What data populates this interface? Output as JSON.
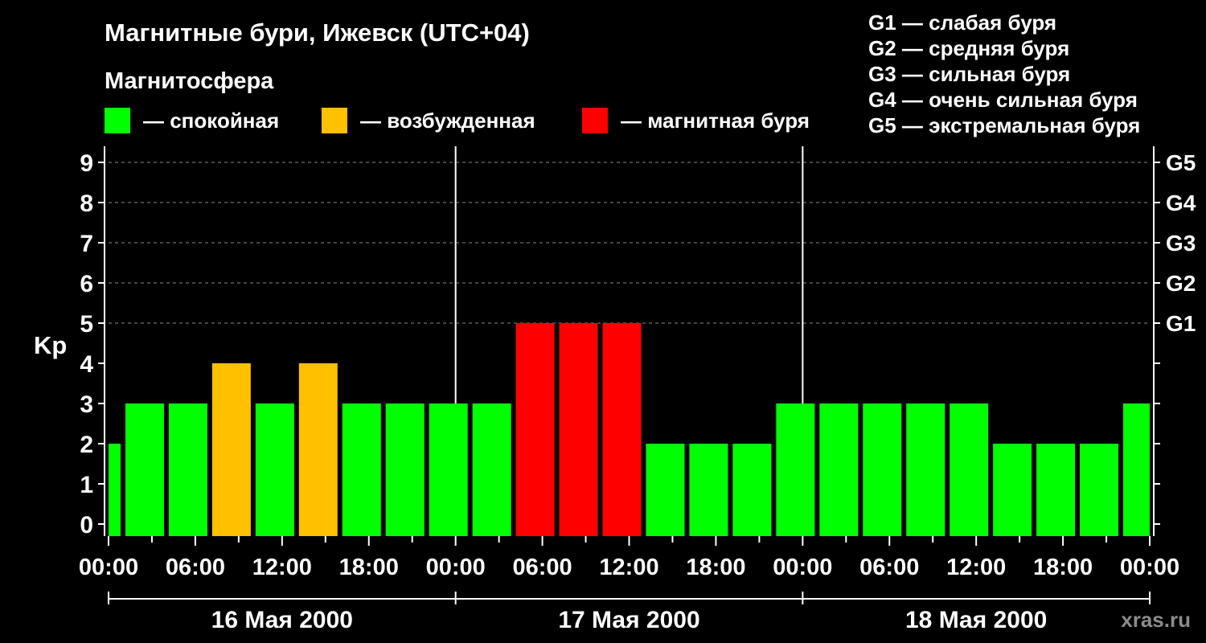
{
  "chart_data": {
    "type": "bar",
    "title": "Магнитные бури, Ижевск (UTC+04)",
    "ylabel": "Kp",
    "ylim": [
      -0.3,
      9.4
    ],
    "yticks": [
      0,
      1,
      2,
      3,
      4,
      5,
      6,
      7,
      8,
      9
    ],
    "xlim": [
      "2000-05-16 00:00",
      "2000-05-19 00:00"
    ],
    "xtick_labels": [
      "00:00",
      "06:00",
      "12:00",
      "18:00",
      "00:00",
      "06:00",
      "12:00",
      "18:00",
      "00:00",
      "06:00",
      "12:00",
      "18:00",
      "00:00"
    ],
    "days": [
      "16 Мая 2000",
      "17 Мая 2000",
      "18 Мая 2000"
    ],
    "grid": true,
    "legend": {
      "title": "Магнитосфера",
      "position": "top-left",
      "items": [
        {
          "label": "— спокойная",
          "color": "#00ff00"
        },
        {
          "label": "— возбужденная",
          "color": "#ffc000"
        },
        {
          "label": "— магнитная буря",
          "color": "#ff0000"
        }
      ]
    },
    "storm_scale": {
      "position": "top-right",
      "levels": [
        {
          "label": "G1",
          "kp": 5,
          "legend": "G1 — слабая буря"
        },
        {
          "label": "G2",
          "kp": 6,
          "legend": "G2 — средняя буря"
        },
        {
          "label": "G3",
          "kp": 7,
          "legend": "G3 — сильная буря"
        },
        {
          "label": "G4",
          "kp": 8,
          "legend": "G4 — очень сильная буря"
        },
        {
          "label": "G5",
          "kp": 9,
          "legend": "G5 — экстремальная буря"
        }
      ]
    },
    "bars": [
      {
        "start": "2000-05-16 00:00",
        "end": "2000-05-16 01:00",
        "kp": 2,
        "color": "#00ff00"
      },
      {
        "start": "2000-05-16 01:00",
        "end": "2000-05-16 04:00",
        "kp": 3,
        "color": "#00ff00"
      },
      {
        "start": "2000-05-16 04:00",
        "end": "2000-05-16 07:00",
        "kp": 3,
        "color": "#00ff00"
      },
      {
        "start": "2000-05-16 07:00",
        "end": "2000-05-16 10:00",
        "kp": 4,
        "color": "#ffc000"
      },
      {
        "start": "2000-05-16 10:00",
        "end": "2000-05-16 13:00",
        "kp": 3,
        "color": "#00ff00"
      },
      {
        "start": "2000-05-16 13:00",
        "end": "2000-05-16 16:00",
        "kp": 4,
        "color": "#ffc000"
      },
      {
        "start": "2000-05-16 16:00",
        "end": "2000-05-16 19:00",
        "kp": 3,
        "color": "#00ff00"
      },
      {
        "start": "2000-05-16 19:00",
        "end": "2000-05-16 22:00",
        "kp": 3,
        "color": "#00ff00"
      },
      {
        "start": "2000-05-16 22:00",
        "end": "2000-05-17 01:00",
        "kp": 3,
        "color": "#00ff00"
      },
      {
        "start": "2000-05-17 01:00",
        "end": "2000-05-17 04:00",
        "kp": 3,
        "color": "#00ff00"
      },
      {
        "start": "2000-05-17 04:00",
        "end": "2000-05-17 07:00",
        "kp": 5,
        "color": "#ff0000"
      },
      {
        "start": "2000-05-17 07:00",
        "end": "2000-05-17 10:00",
        "kp": 5,
        "color": "#ff0000"
      },
      {
        "start": "2000-05-17 10:00",
        "end": "2000-05-17 13:00",
        "kp": 5,
        "color": "#ff0000"
      },
      {
        "start": "2000-05-17 13:00",
        "end": "2000-05-17 16:00",
        "kp": 2,
        "color": "#00ff00"
      },
      {
        "start": "2000-05-17 16:00",
        "end": "2000-05-17 19:00",
        "kp": 2,
        "color": "#00ff00"
      },
      {
        "start": "2000-05-17 19:00",
        "end": "2000-05-17 22:00",
        "kp": 2,
        "color": "#00ff00"
      },
      {
        "start": "2000-05-17 22:00",
        "end": "2000-05-18 01:00",
        "kp": 3,
        "color": "#00ff00"
      },
      {
        "start": "2000-05-18 01:00",
        "end": "2000-05-18 04:00",
        "kp": 3,
        "color": "#00ff00"
      },
      {
        "start": "2000-05-18 04:00",
        "end": "2000-05-18 07:00",
        "kp": 3,
        "color": "#00ff00"
      },
      {
        "start": "2000-05-18 07:00",
        "end": "2000-05-18 10:00",
        "kp": 3,
        "color": "#00ff00"
      },
      {
        "start": "2000-05-18 10:00",
        "end": "2000-05-18 13:00",
        "kp": 3,
        "color": "#00ff00"
      },
      {
        "start": "2000-05-18 13:00",
        "end": "2000-05-18 16:00",
        "kp": 2,
        "color": "#00ff00"
      },
      {
        "start": "2000-05-18 16:00",
        "end": "2000-05-18 19:00",
        "kp": 2,
        "color": "#00ff00"
      },
      {
        "start": "2000-05-18 19:00",
        "end": "2000-05-18 22:00",
        "kp": 2,
        "color": "#00ff00"
      },
      {
        "start": "2000-05-18 22:00",
        "end": "2000-05-19 00:00",
        "kp": 3,
        "color": "#00ff00"
      }
    ]
  },
  "watermark": "xras.ru"
}
